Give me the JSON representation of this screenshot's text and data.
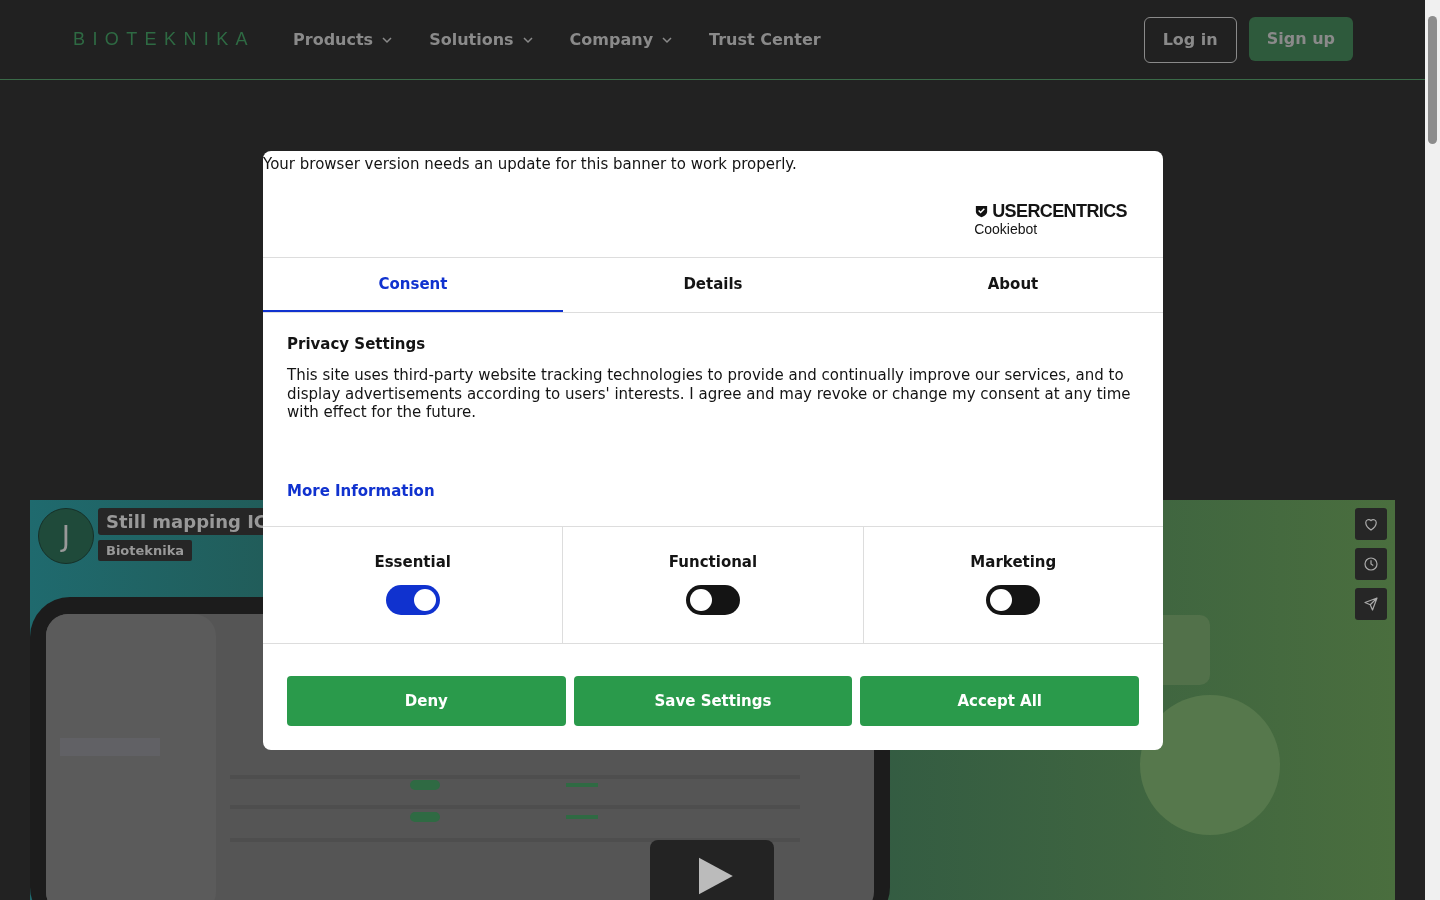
{
  "nav": {
    "logo": "BIOTEKNIKA",
    "links": [
      {
        "label": "Products",
        "dropdown": true
      },
      {
        "label": "Solutions",
        "dropdown": true
      },
      {
        "label": "Company",
        "dropdown": true
      },
      {
        "label": "Trust Center",
        "dropdown": false
      }
    ],
    "login": "Log in",
    "signup": "Sign up"
  },
  "video": {
    "avatar": "J",
    "title": "Still mapping IC",
    "channel": "Bioteknika"
  },
  "cookie_dialog": {
    "notice": "Your browser version needs an update for this banner to work properly.",
    "brand": "USERCENTRICS",
    "brand_sub": "Cookiebot",
    "tabs": [
      {
        "label": "Consent",
        "selected": true
      },
      {
        "label": "Details",
        "selected": false
      },
      {
        "label": "About",
        "selected": false
      }
    ],
    "heading": "Privacy Settings",
    "body": "This site uses third-party website tracking technologies to provide and continually improve our services, and to display advertisements according to users' interests. I agree and may revoke or change my consent at any time with effect for the future.",
    "more_link": "More Information",
    "categories": [
      {
        "label": "Essential",
        "on": true
      },
      {
        "label": "Functional",
        "on": false
      },
      {
        "label": "Marketing",
        "on": false
      }
    ],
    "buttons": [
      "Deny",
      "Save Settings",
      "Accept All"
    ]
  }
}
